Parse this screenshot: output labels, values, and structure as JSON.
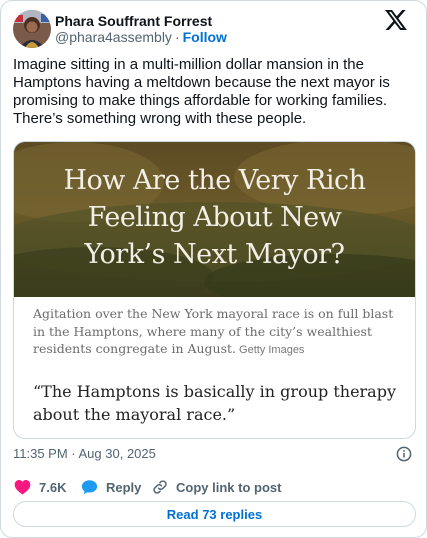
{
  "author": {
    "name": "Phara Souffrant Forrest",
    "handle": "@phara4assembly",
    "separator": "·",
    "follow_label": "Follow"
  },
  "tweet": {
    "text": "Imagine sitting in a multi-million dollar mansion in the Hamptons having a meltdown because the next mayor is promising to make things affordable for working families. There’s something wrong with these people."
  },
  "article": {
    "headline_lines": [
      "How Are the Very Rich",
      "Feeling About New",
      "York’s Next Mayor?"
    ],
    "caption": "Agitation over the New York mayoral race is on full blast in the Hamptons, where many of the city’s wealthiest residents congregate in August.",
    "image_credit": "Getty Images",
    "pull_quote": "“The Hamptons is basically in group therapy about the mayoral race.”"
  },
  "meta": {
    "timestamp": "11:35 PM · Aug 30, 2025"
  },
  "actions": {
    "like_count": "7.6K",
    "reply_label": "Reply",
    "copy_label": "Copy link to post"
  },
  "replies_button": {
    "label": "Read 73 replies"
  },
  "colors": {
    "link_blue": "#006fd6",
    "like_pink": "#f91880",
    "reply_blue": "#1d9bf0",
    "muted_gray": "#536471",
    "border": "#cfd9de"
  },
  "icons": {
    "brand": "x-logo-icon",
    "like": "heart-icon",
    "reply": "speech-bubble-icon",
    "copy": "link-icon",
    "info": "info-icon"
  }
}
